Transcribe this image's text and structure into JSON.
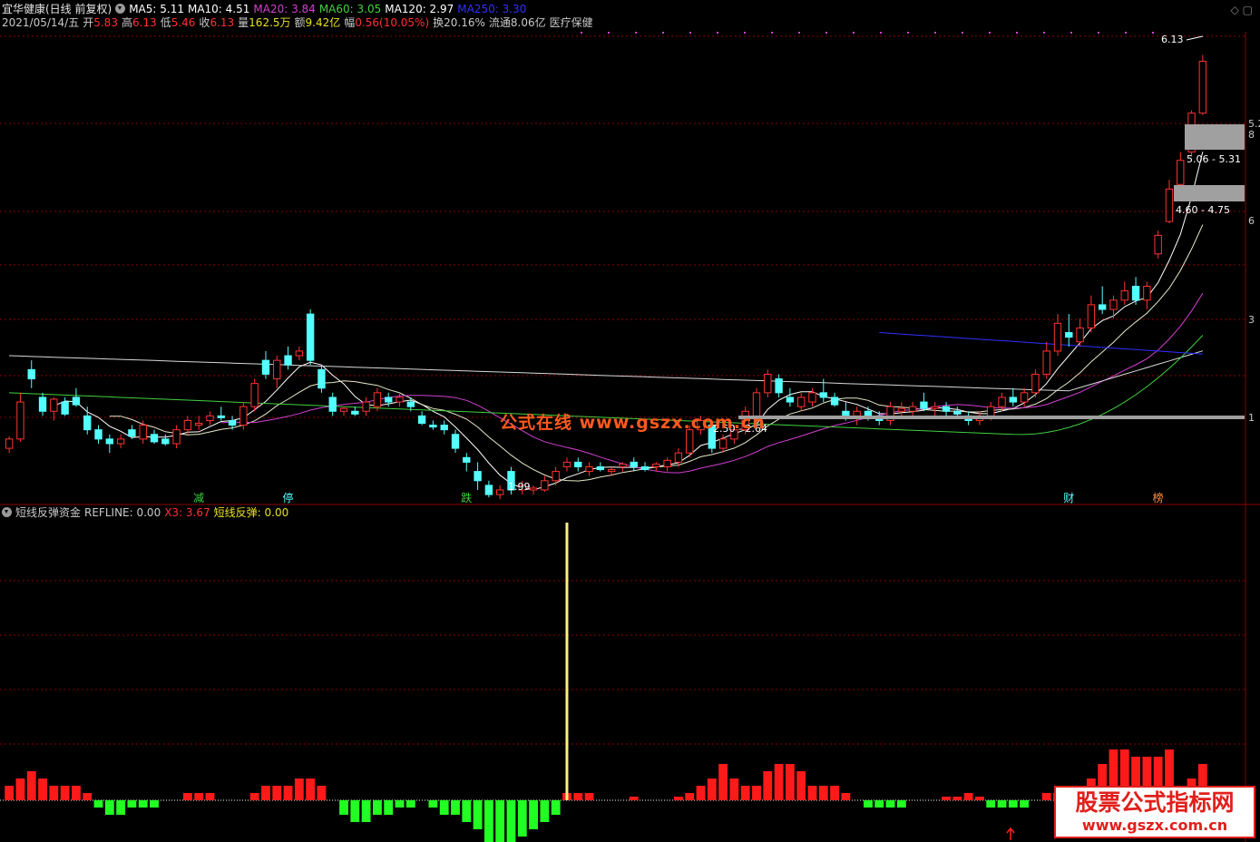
{
  "header": {
    "stock": "宜华健康(日线 前复权)",
    "ma": [
      {
        "label": "MA5: 5.11",
        "color": "#ffffff"
      },
      {
        "label": "MA10: 4.51",
        "color": "#ffffff"
      },
      {
        "label": "MA20: 3.84",
        "color": "#d040d0"
      },
      {
        "label": "MA60: 3.05",
        "color": "#40d040"
      },
      {
        "label": "MA120: 2.97",
        "color": "#ffffff"
      },
      {
        "label": "MA250: 3.30",
        "color": "#3030ff"
      }
    ],
    "info": [
      {
        "label": "2021/05/14/五",
        "color": "#c8c8c8"
      },
      {
        "label": "开",
        "color": "#c8c8c8"
      },
      {
        "label": "5.83",
        "color": "#ff3030"
      },
      {
        "label": "高",
        "color": "#c8c8c8"
      },
      {
        "label": "6.13",
        "color": "#ff3030"
      },
      {
        "label": "低",
        "color": "#c8c8c8"
      },
      {
        "label": "5.46",
        "color": "#ff3030"
      },
      {
        "label": "收",
        "color": "#c8c8c8"
      },
      {
        "label": "6.13",
        "color": "#ff3030"
      },
      {
        "label": "量",
        "color": "#c8c8c8"
      },
      {
        "label": "162.5万",
        "color": "#e8e020"
      },
      {
        "label": "额",
        "color": "#c8c8c8"
      },
      {
        "label": "9.42亿",
        "color": "#e8e020"
      },
      {
        "label": "幅",
        "color": "#c8c8c8"
      },
      {
        "label": "0.56(10.05%)",
        "color": "#ff3030"
      },
      {
        "label": "换20.16%",
        "color": "#c8c8c8"
      },
      {
        "label": "流通8.06亿",
        "color": "#c8c8c8"
      },
      {
        "label": "医疗保健",
        "color": "#c8c8c8"
      }
    ]
  },
  "indicator_header": [
    {
      "label": "短线反弹资金",
      "color": "#c8c8c8"
    },
    {
      "label": "REFLINE: 0.00",
      "color": "#c8c8c8"
    },
    {
      "label": "X3: 3.67",
      "color": "#ff3030"
    },
    {
      "label": "短线反弹: 0.00",
      "color": "#e8e020"
    }
  ],
  "watermark": {
    "text": "公式在线  www.gszx.com.cn"
  },
  "watermark2": {
    "line1": "股票公式指标网",
    "line2": "www.gszx.com.cn"
  },
  "colors": {
    "up": "#ff3232",
    "down": "#54ffff",
    "grid": "#8b0000",
    "pos_bar": "#ff1a1a",
    "neg_bar": "#22ff22",
    "spike": "#ffef80"
  },
  "chart_data": {
    "type": "candlestick",
    "price_annotations": [
      {
        "text": "6.13",
        "x_index": 101
      },
      {
        "text": "1.99",
        "x_index": 43
      },
      {
        "text": "5.06 - 5.31",
        "x_index": 99
      },
      {
        "text": "4.60 - 4.75",
        "x_index": 99
      },
      {
        "text": "2.50 - 2.64",
        "x_index": 62
      }
    ],
    "axis_labels": [
      "5.2",
      "8",
      "6",
      "3",
      "1"
    ],
    "event_markers": [
      {
        "text": "减",
        "x_index": 17,
        "color": "#40d040"
      },
      {
        "text": "停",
        "x_index": 25,
        "color": "#54ffff"
      },
      {
        "text": "跌",
        "x_index": 41,
        "color": "#40d040"
      },
      {
        "text": "财",
        "x_index": 95,
        "color": "#54ffff"
      },
      {
        "text": "榜",
        "x_index": 103,
        "color": "#ff9040"
      }
    ],
    "ylim": [
      1.5,
      6.4
    ],
    "candles": [
      [
        1.95,
        2.08,
        1.9,
        2.05
      ],
      [
        2.05,
        2.55,
        2.02,
        2.45
      ],
      [
        2.8,
        2.9,
        2.6,
        2.7
      ],
      [
        2.5,
        2.55,
        2.3,
        2.35
      ],
      [
        2.35,
        2.5,
        2.25,
        2.48
      ],
      [
        2.45,
        2.5,
        2.3,
        2.32
      ],
      [
        2.5,
        2.6,
        2.4,
        2.42
      ],
      [
        2.3,
        2.4,
        2.1,
        2.15
      ],
      [
        2.15,
        2.2,
        2.0,
        2.05
      ],
      [
        2.05,
        2.1,
        1.9,
        2.0
      ],
      [
        2.0,
        2.1,
        1.95,
        2.05
      ],
      [
        2.15,
        2.2,
        2.05,
        2.08
      ],
      [
        2.05,
        2.25,
        2.0,
        2.2
      ],
      [
        2.1,
        2.15,
        2.0,
        2.02
      ],
      [
        2.05,
        2.1,
        1.98,
        2.0
      ],
      [
        2.0,
        2.2,
        1.95,
        2.15
      ],
      [
        2.15,
        2.3,
        2.1,
        2.25
      ],
      [
        2.2,
        2.3,
        2.15,
        2.22
      ],
      [
        2.25,
        2.35,
        2.2,
        2.3
      ],
      [
        2.3,
        2.4,
        2.25,
        2.28
      ],
      [
        2.25,
        2.3,
        2.15,
        2.2
      ],
      [
        2.2,
        2.45,
        2.15,
        2.4
      ],
      [
        2.4,
        2.7,
        2.35,
        2.65
      ],
      [
        2.9,
        3.0,
        2.7,
        2.75
      ],
      [
        2.7,
        2.95,
        2.6,
        2.9
      ],
      [
        2.95,
        3.05,
        2.8,
        2.85
      ],
      [
        2.95,
        3.05,
        2.9,
        3.0
      ],
      [
        3.4,
        3.45,
        2.85,
        2.9
      ],
      [
        2.8,
        2.85,
        2.55,
        2.6
      ],
      [
        2.5,
        2.55,
        2.3,
        2.35
      ],
      [
        2.35,
        2.4,
        2.3,
        2.38
      ],
      [
        2.35,
        2.4,
        2.3,
        2.32
      ],
      [
        2.35,
        2.5,
        2.3,
        2.45
      ],
      [
        2.4,
        2.6,
        2.35,
        2.55
      ],
      [
        2.5,
        2.55,
        2.4,
        2.45
      ],
      [
        2.45,
        2.55,
        2.4,
        2.5
      ],
      [
        2.45,
        2.5,
        2.35,
        2.4
      ],
      [
        2.3,
        2.35,
        2.2,
        2.22
      ],
      [
        2.2,
        2.25,
        2.15,
        2.18
      ],
      [
        2.2,
        2.25,
        2.1,
        2.15
      ],
      [
        2.1,
        2.15,
        1.9,
        1.95
      ],
      [
        1.85,
        1.9,
        1.7,
        1.8
      ],
      [
        1.7,
        1.8,
        1.5,
        1.6
      ],
      [
        1.55,
        1.6,
        1.42,
        1.45
      ],
      [
        1.45,
        1.55,
        1.4,
        1.5
      ],
      [
        1.7,
        1.75,
        1.45,
        1.5
      ],
      [
        1.5,
        1.6,
        1.45,
        1.55
      ],
      [
        1.5,
        1.55,
        1.45,
        1.52
      ],
      [
        1.5,
        1.65,
        1.48,
        1.6
      ],
      [
        1.6,
        1.75,
        1.55,
        1.7
      ],
      [
        1.75,
        1.85,
        1.7,
        1.8
      ],
      [
        1.8,
        1.85,
        1.7,
        1.75
      ],
      [
        1.7,
        1.8,
        1.65,
        1.75
      ],
      [
        1.75,
        1.8,
        1.7,
        1.72
      ],
      [
        1.7,
        1.75,
        1.65,
        1.72
      ],
      [
        1.75,
        1.8,
        1.7,
        1.78
      ],
      [
        1.8,
        1.85,
        1.7,
        1.75
      ],
      [
        1.75,
        1.8,
        1.7,
        1.72
      ],
      [
        1.75,
        1.8,
        1.7,
        1.78
      ],
      [
        1.75,
        1.85,
        1.7,
        1.82
      ],
      [
        1.8,
        1.95,
        1.75,
        1.9
      ],
      [
        1.9,
        2.2,
        1.85,
        2.15
      ],
      [
        2.15,
        2.3,
        2.1,
        2.25
      ],
      [
        2.2,
        2.25,
        1.9,
        1.95
      ],
      [
        1.95,
        2.1,
        1.9,
        2.05
      ],
      [
        2.05,
        2.2,
        2.0,
        2.15
      ],
      [
        2.15,
        2.4,
        2.1,
        2.35
      ],
      [
        2.3,
        2.6,
        2.25,
        2.55
      ],
      [
        2.55,
        2.8,
        2.5,
        2.75
      ],
      [
        2.7,
        2.75,
        2.5,
        2.55
      ],
      [
        2.5,
        2.6,
        2.4,
        2.45
      ],
      [
        2.4,
        2.55,
        2.35,
        2.5
      ],
      [
        2.45,
        2.6,
        2.4,
        2.55
      ],
      [
        2.55,
        2.7,
        2.45,
        2.5
      ],
      [
        2.5,
        2.55,
        2.4,
        2.42
      ],
      [
        2.35,
        2.45,
        2.25,
        2.3
      ],
      [
        2.3,
        2.4,
        2.2,
        2.35
      ],
      [
        2.35,
        2.4,
        2.25,
        2.3
      ],
      [
        2.3,
        2.35,
        2.2,
        2.25
      ],
      [
        2.25,
        2.45,
        2.2,
        2.4
      ],
      [
        2.35,
        2.45,
        2.3,
        2.38
      ],
      [
        2.35,
        2.45,
        2.3,
        2.4
      ],
      [
        2.45,
        2.55,
        2.35,
        2.38
      ],
      [
        2.38,
        2.45,
        2.3,
        2.4
      ],
      [
        2.4,
        2.45,
        2.3,
        2.35
      ],
      [
        2.35,
        2.4,
        2.28,
        2.32
      ],
      [
        2.3,
        2.35,
        2.2,
        2.25
      ],
      [
        2.25,
        2.35,
        2.2,
        2.3
      ],
      [
        2.3,
        2.45,
        2.25,
        2.4
      ],
      [
        2.4,
        2.55,
        2.35,
        2.5
      ],
      [
        2.5,
        2.6,
        2.4,
        2.45
      ],
      [
        2.45,
        2.6,
        2.4,
        2.55
      ],
      [
        2.55,
        2.8,
        2.5,
        2.75
      ],
      [
        2.75,
        3.1,
        2.7,
        3.0
      ],
      [
        3.0,
        3.4,
        2.95,
        3.3
      ],
      [
        3.2,
        3.4,
        3.05,
        3.15
      ],
      [
        3.1,
        3.35,
        3.05,
        3.25
      ],
      [
        3.25,
        3.6,
        3.2,
        3.5
      ],
      [
        3.5,
        3.7,
        3.4,
        3.45
      ],
      [
        3.45,
        3.6,
        3.35,
        3.55
      ],
      [
        3.55,
        3.75,
        3.5,
        3.65
      ],
      [
        3.7,
        3.8,
        3.5,
        3.55
      ],
      [
        3.55,
        3.75,
        3.45,
        3.7
      ],
      [
        4.05,
        4.3,
        4.0,
        4.25
      ],
      [
        4.4,
        4.85,
        4.38,
        4.75
      ],
      [
        4.8,
        5.15,
        4.78,
        5.06
      ],
      [
        5.15,
        5.6,
        5.1,
        5.57
      ],
      [
        5.57,
        6.2,
        5.55,
        6.13
      ]
    ],
    "indicator": {
      "refline": 0,
      "spike_index": 50,
      "bars": [
        2,
        3,
        4,
        3,
        2,
        2,
        2,
        1,
        -1,
        -2,
        -2,
        -1,
        -1,
        -1,
        0,
        0,
        1,
        1,
        1,
        0,
        0,
        0,
        1,
        2,
        2,
        2,
        3,
        3,
        2,
        0,
        -2,
        -3,
        -3,
        -2,
        -2,
        -1,
        -1,
        0,
        -1,
        -2,
        -2,
        -3,
        -4,
        -6,
        -7,
        -6,
        -5,
        -4,
        -3,
        -2,
        1,
        1,
        1,
        0,
        0,
        0,
        0.5,
        0,
        0,
        0,
        0.5,
        1,
        2,
        3,
        5,
        3,
        2,
        2,
        4,
        5,
        5,
        4,
        2,
        2,
        2,
        1,
        0,
        -1,
        -1,
        -1,
        -1,
        0,
        0,
        0,
        0.5,
        0.5,
        1,
        0.5,
        -1,
        -1,
        -1,
        -1,
        0,
        1,
        1,
        1,
        2,
        3,
        5,
        7,
        7,
        6,
        6,
        6,
        7,
        2,
        3,
        5,
        10,
        14
      ]
    }
  }
}
